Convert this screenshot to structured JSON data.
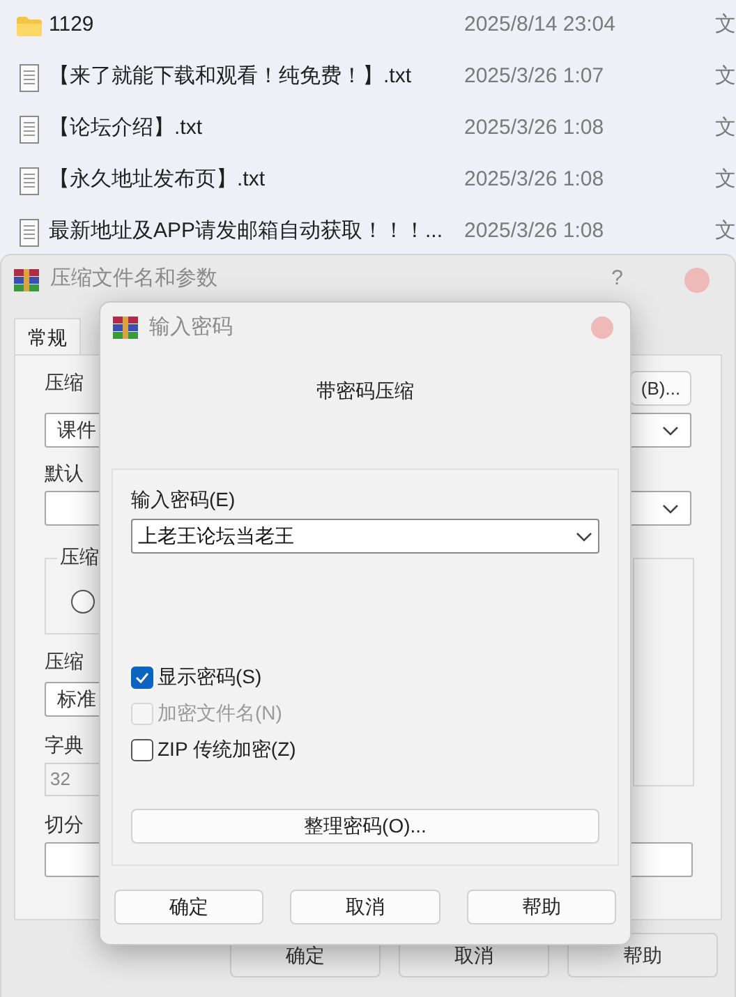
{
  "file_list": [
    {
      "kind": "folder",
      "name": "1129",
      "modified": "2025/8/14 23:04",
      "type": "文"
    },
    {
      "kind": "text",
      "name": "【来了就能下载和观看！纯免费！】.txt",
      "modified": "2025/3/26 1:07",
      "type": "文"
    },
    {
      "kind": "text",
      "name": "【论坛介绍】.txt",
      "modified": "2025/3/26 1:08",
      "type": "文"
    },
    {
      "kind": "text",
      "name": "【永久地址发布页】.txt",
      "modified": "2025/3/26 1:08",
      "type": "文"
    },
    {
      "kind": "text",
      "name": "最新地址及APP请发邮箱自动获取！！！...",
      "modified": "2025/3/26 1:08",
      "type": "文"
    }
  ],
  "background_window": {
    "title": "压缩文件名和参数",
    "help": "?",
    "tabs": [
      {
        "label": "常规",
        "selected": true
      }
    ],
    "archive_name_label": "压缩",
    "browse_button": "(B)...",
    "archive_name_value": "课件",
    "profile_label": "默认",
    "group_label": "压缩",
    "radio": {
      "selected": false
    },
    "method_label": "压缩",
    "method_value": "标准",
    "dictionary_label": "字典",
    "dictionary_value": "32",
    "split_label": "切分",
    "buttons": [
      "确定",
      "取消",
      "帮助"
    ]
  },
  "dialog": {
    "title": "输入密码",
    "heading": "带密码压缩",
    "password_label": "输入密码(E)",
    "password_value": "上老王论坛当老王",
    "options": [
      {
        "label": "显示密码(S)",
        "checked": true,
        "disabled": false
      },
      {
        "label": "加密文件名(N)",
        "checked": false,
        "disabled": true
      },
      {
        "label": "ZIP 传统加密(Z)",
        "checked": false,
        "disabled": false
      }
    ],
    "manage_button": "整理密码(O)...",
    "buttons": [
      "确定",
      "取消",
      "帮助"
    ]
  }
}
